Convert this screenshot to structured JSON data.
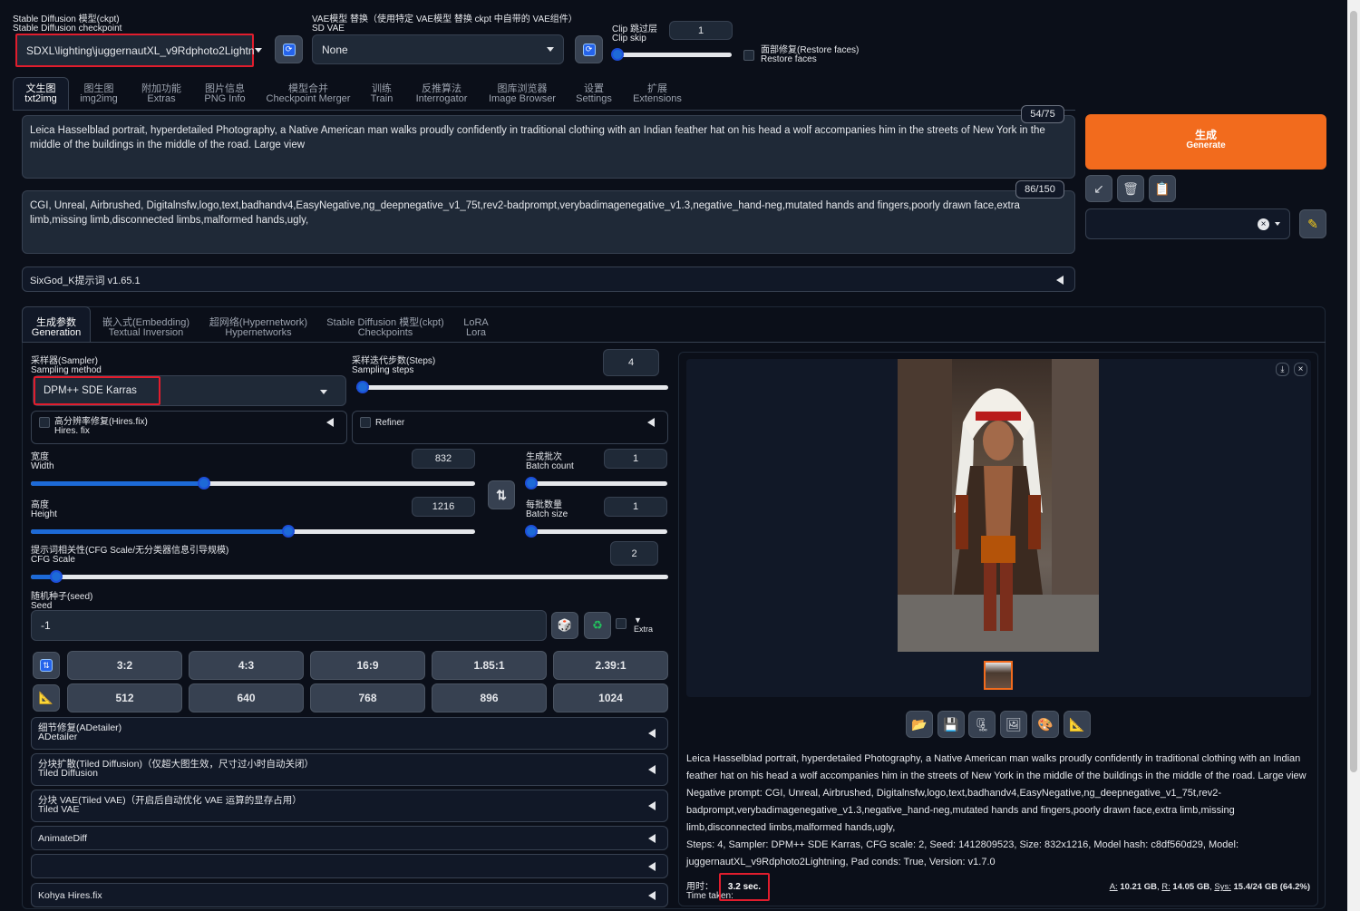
{
  "top": {
    "checkpoint": {
      "label_zh": "Stable Diffusion 模型(ckpt)",
      "label_en": "Stable Diffusion checkpoint",
      "value": "SDXL\\lighting\\juggernautXL_v9Rdphoto2Lightn"
    },
    "vae": {
      "label_zh": "VAE模型 替换（使用特定 VAE模型 替换 ckpt 中自带的 VAE组件）",
      "label_en": "SD VAE",
      "value": "None"
    },
    "clip_skip": {
      "label_zh": "Clip 跳过层",
      "label_en": "Clip skip",
      "value": "1",
      "level": 0
    },
    "restore_faces": {
      "label_zh": "面部修复(Restore faces)",
      "label_en": "Restore faces",
      "checked": false
    }
  },
  "main_tabs": [
    {
      "zh": "文生图",
      "en": "txt2img"
    },
    {
      "zh": "图生图",
      "en": "img2img"
    },
    {
      "zh": "附加功能",
      "en": "Extras"
    },
    {
      "zh": "图片信息",
      "en": "PNG Info"
    },
    {
      "zh": "模型合并",
      "en": "Checkpoint Merger"
    },
    {
      "zh": "训练",
      "en": "Train"
    },
    {
      "zh": "反推算法",
      "en": "Interrogator"
    },
    {
      "zh": "图库浏览器",
      "en": "Image Browser"
    },
    {
      "zh": "设置",
      "en": "Settings"
    },
    {
      "zh": "扩展",
      "en": "Extensions"
    }
  ],
  "prompt": {
    "text": "Leica Hasselblad portrait, hyperdetailed Photography, a Native American man walks proudly confidently in traditional clothing with an Indian feather hat on his head a wolf accompanies him in the streets of New York in the middle of the buildings in the middle of the road. Large view",
    "token_count": "54/75"
  },
  "negative_prompt": {
    "text": "CGI, Unreal, Airbrushed, Digitalnsfw,logo,text,badhandv4,EasyNegative,ng_deepnegative_v1_75t,rev2-badprompt,verybadimagenegative_v1.3,negative_hand-neg,mutated hands and fingers,poorly drawn face,extra limb,missing limb,disconnected limbs,malformed hands,ugly,",
    "token_count": "86/150"
  },
  "generate": {
    "zh": "生成",
    "en": "Generate"
  },
  "sixgod": {
    "label": "SixGod_K提示词 v1.65.1"
  },
  "sub_tabs": [
    {
      "zh": "生成参数",
      "en": "Generation"
    },
    {
      "zh": "嵌入式(Embedding)",
      "en": "Textual Inversion"
    },
    {
      "zh": "超网络(Hypernetwork)",
      "en": "Hypernetworks"
    },
    {
      "zh": "Stable Diffusion 模型(ckpt)",
      "en": "Checkpoints"
    },
    {
      "zh": "LoRA",
      "en": "Lora"
    }
  ],
  "sampler": {
    "label_zh": "采样器(Sampler)",
    "label_en": "Sampling method",
    "value": "DPM++ SDE Karras"
  },
  "steps": {
    "label_zh": "采样迭代步数(Steps)",
    "label_en": "Sampling steps",
    "value": "4",
    "level": 0.02
  },
  "hires": {
    "label_zh": "高分辨率修复(Hires.fix)",
    "label_en": "Hires. fix"
  },
  "refiner": {
    "label": "Refiner"
  },
  "width": {
    "label_zh": "宽度",
    "label_en": "Width",
    "value": "832",
    "level": 0.39
  },
  "height": {
    "label_zh": "高度",
    "label_en": "Height",
    "value": "1216",
    "level": 0.58
  },
  "batch_count": {
    "label_zh": "生成批次",
    "label_en": "Batch count",
    "value": "1",
    "level": 0
  },
  "batch_size": {
    "label_zh": "每批数量",
    "label_en": "Batch size",
    "value": "1",
    "level": 0
  },
  "swap_icon": "⇅",
  "cfg": {
    "label_zh": "提示词相关性(CFG Scale/无分类器信息引导规模)",
    "label_en": "CFG Scale",
    "value": "2",
    "level": 0.04
  },
  "seed": {
    "label_zh": "随机种子(seed)",
    "label_en": "Seed",
    "value": "-1",
    "extra": "Extra"
  },
  "ratios": [
    "3:2",
    "4:3",
    "16:9",
    "1.85:1",
    "2.39:1"
  ],
  "sizes": [
    "512",
    "640",
    "768",
    "896",
    "1024"
  ],
  "accordions": [
    {
      "zh": "细节修复(ADetailer)",
      "en": "ADetailer"
    },
    {
      "zh": "分块扩散(Tiled Diffusion)（仅超大图生效，尺寸过小时自动关闭）",
      "en": "Tiled Diffusion"
    },
    {
      "zh": "分块 VAE(Tiled VAE)（开启后自动优化 VAE 运算的显存占用）",
      "en": "Tiled VAE"
    },
    {
      "zh": "AnimateDiff",
      "en": ""
    },
    {
      "zh": "",
      "en": ""
    },
    {
      "zh": "Kohya Hires.fix",
      "en": ""
    }
  ],
  "output": {
    "info_prompt": "Leica Hasselblad portrait, hyperdetailed Photography, a Native American man walks proudly confidently in traditional clothing with an Indian feather hat on his head a wolf accompanies him in the streets of New York in the middle of the buildings in the middle of the road. Large view",
    "info_negative": "Negative prompt: CGI, Unreal, Airbrushed, Digitalnsfw,logo,text,badhandv4,EasyNegative,ng_deepnegative_v1_75t,rev2-badprompt,verybadimagenegative_v1.3,negative_hand-neg,mutated hands and fingers,poorly drawn face,extra limb,missing limb,disconnected limbs,malformed hands,ugly,",
    "info_params": "Steps: 4, Sampler: DPM++ SDE Karras, CFG scale: 2, Seed: 1412809523, Size: 832x1216, Model hash: c8df560d29, Model: juggernautXL_v9Rdphoto2Lightning, Pad conds: True, Version: v1.7.0",
    "time_label_zh": "用时：",
    "time_label_en": "Time taken:",
    "time_value": "3.2 sec.",
    "vram_a_label": "A:",
    "vram_a": "10.21 GB",
    "vram_r_label": "R:",
    "vram_r": "14.05 GB",
    "vram_sys_label": "Sys:",
    "vram_sys": "15.4/24 GB (64.2%)"
  },
  "colors": {
    "accent": "#f26b1d",
    "slider": "#1d6ad7",
    "highlight": "#e11d2d",
    "bg": "#0b0f19"
  }
}
